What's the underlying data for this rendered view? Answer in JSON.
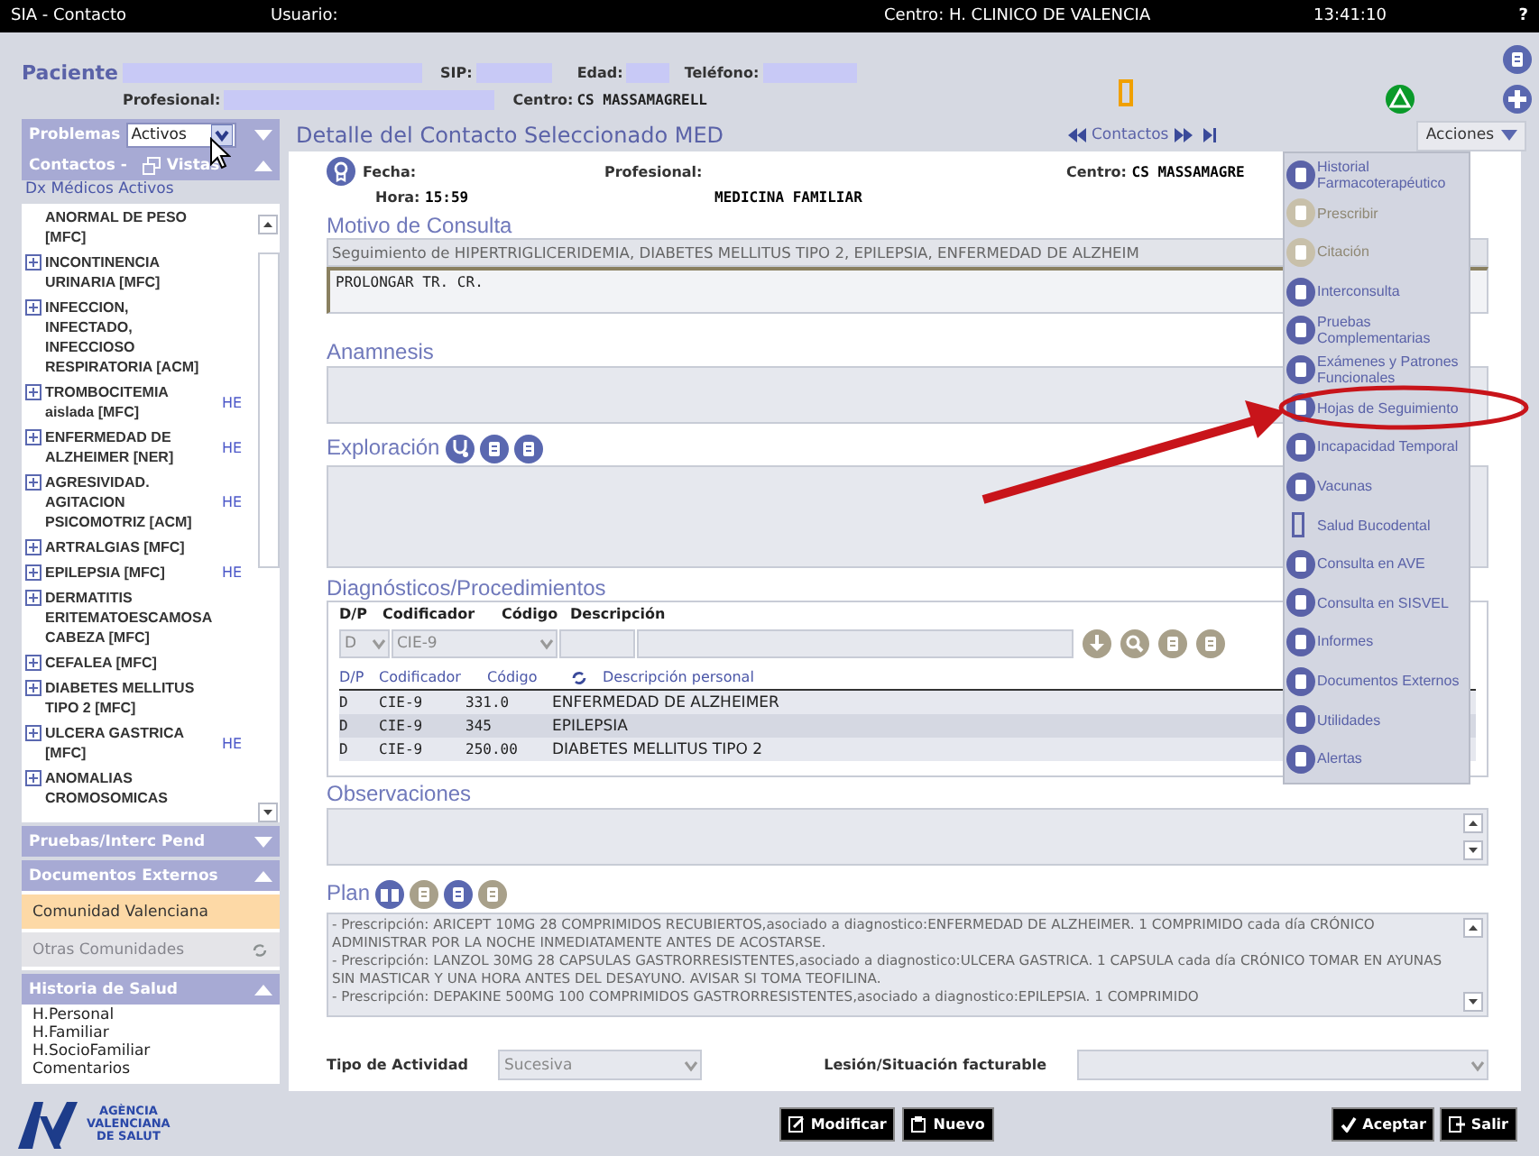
{
  "top_bar": {
    "title": "SIA - Contacto",
    "user_label": "Usuario:",
    "center": "Centro: H. CLINICO DE VALENCIA",
    "time": "13:41:10",
    "help": "?"
  },
  "patient": {
    "label": "Paciente",
    "sip_label": "SIP:",
    "age_label": "Edad:",
    "phone_label": "Teléfono:",
    "professional_label": "Profesional:",
    "center_label": "Centro:",
    "center": "CS MASSAMAGRELL"
  },
  "sidebar": {
    "problems": {
      "label": "Problemas",
      "filter": "Activos",
      "expanded": false
    },
    "contacts": {
      "label": "Contactos -",
      "views": "Vistas",
      "expanded": true
    },
    "list_title": "Dx Médicos Activos",
    "items": [
      {
        "name": "ANORMAL DE PESO [MFC]",
        "expander": false
      },
      {
        "name": "INCONTINENCIA URINARIA [MFC]",
        "expander": true
      },
      {
        "name": "INFECCION, INFECTADO, INFECCIOSO RESPIRATORIA [ACM]",
        "expander": true
      },
      {
        "name": "TROMBOCITEMIA aislada [MFC]",
        "expander": true,
        "tag": "HE"
      },
      {
        "name": "ENFERMEDAD DE ALZHEIMER [NER]",
        "expander": true,
        "tag": "HE"
      },
      {
        "name": "AGRESIVIDAD. AGITACION PSICOMOTRIZ [ACM]",
        "expander": true,
        "tag": "HE"
      },
      {
        "name": "ARTRALGIAS [MFC]",
        "expander": true
      },
      {
        "name": "EPILEPSIA [MFC]",
        "expander": true,
        "tag": "HE"
      },
      {
        "name": "DERMATITIS ERITEMATOESCAMOSA CABEZA [MFC]",
        "expander": true
      },
      {
        "name": "CEFALEA [MFC]",
        "expander": true
      },
      {
        "name": "DIABETES MELLITUS TIPO 2 [MFC]",
        "expander": true
      },
      {
        "name": "ULCERA GASTRICA [MFC]",
        "expander": true,
        "tag": "HE"
      },
      {
        "name": "ANOMALIAS CROMOSOMICAS",
        "expander": true
      }
    ],
    "sections": [
      {
        "title": "Pruebas/Interc Pend",
        "expanded": false
      },
      {
        "title": "Documentos Externos",
        "expanded": true,
        "kind": "tabs",
        "items": [
          {
            "label": "Comunidad Valenciana",
            "selected": true,
            "disabled": false
          },
          {
            "label": "Otras Comunidades",
            "selected": false,
            "disabled": true
          }
        ]
      },
      {
        "title": "Historia de Salud",
        "expanded": true,
        "kind": "links",
        "items": [
          {
            "label": "H.Personal"
          },
          {
            "label": "H.Familiar"
          },
          {
            "label": "H.SocioFamiliar"
          },
          {
            "label": "Comentarios"
          }
        ]
      }
    ]
  },
  "main": {
    "title": "Detalle del Contacto Seleccionado MED",
    "nav_label": "Contactos",
    "actions_label": "Acciones",
    "contact": {
      "date_label": "Fecha:",
      "professional_label": "Profesional:",
      "center_label": "Centro:",
      "center": "CS MASSAMAGRE",
      "time_label": "Hora:",
      "time": "15:59",
      "specialty": "MEDICINA FAMILIAR"
    },
    "reason": {
      "title": "Motivo de Consulta",
      "summary": "Seguimiento de HIPERTRIGLICERIDEMIA, DIABETES MELLITUS TIPO 2, EPILEPSIA, ENFERMEDAD DE ALZHEIM",
      "value": "PROLONGAR TR. CR."
    },
    "anamnesis": {
      "title": "Anamnesis"
    },
    "exploration": {
      "title": "Exploración"
    },
    "diagnoses": {
      "title": "Diagnósticos/Procedimientos",
      "entry_labels": [
        "D/P",
        "Codificador",
        "Código",
        "Descripción"
      ],
      "entry": {
        "type": "D",
        "coder": "CIE-9"
      },
      "columns": [
        "D/P",
        "Codificador",
        "Código",
        "Descripción personal"
      ],
      "rows": [
        [
          "D",
          "CIE-9",
          "331.0",
          "ENFERMEDAD DE ALZHEIMER"
        ],
        [
          "D",
          "CIE-9",
          "345",
          "EPILEPSIA"
        ],
        [
          "D",
          "CIE-9",
          "250.00",
          "DIABETES MELLITUS TIPO 2"
        ]
      ]
    },
    "observations": {
      "title": "Observaciones"
    },
    "plan": {
      "title": "Plan",
      "text": [
        "- Prescripción: ARICEPT 10MG 28 COMPRIMIDOS RECUBIERTOS,asociado a diagnostico:ENFERMEDAD DE ALZHEIMER. 1 COMPRIMIDO cada día CRÓNICO ADMINISTRAR POR LA NOCHE INMEDIATAMENTE ANTES DE ACOSTARSE.",
        "- Prescripción: LANZOL 30MG 28 CAPSULAS GASTRORRESISTENTES,asociado a diagnostico:ULCERA GASTRICA. 1 CAPSULA cada día CRÓNICO TOMAR EN AYUNAS SIN MASTICAR Y UNA HORA ANTES DEL DESAYUNO. AVISAR SI TOMA TEOFILINA.",
        "- Prescripción: DEPAKINE 500MG 100 COMPRIMIDOS GASTRORRESISTENTES,asociado a diagnostico:EPILEPSIA. 1 COMPRIMIDO"
      ]
    },
    "activity": {
      "label": "Tipo de Actividad",
      "value": "Sucesiva"
    },
    "billable": {
      "label": "Lesión/Situación facturable"
    }
  },
  "actions_menu": [
    {
      "label": "Historial Farmacoterapéutico",
      "disabled": false
    },
    {
      "label": "Prescribir",
      "disabled": true
    },
    {
      "label": "Citación",
      "disabled": true
    },
    {
      "label": "Interconsulta",
      "disabled": false
    },
    {
      "label": "Pruebas Complementarias",
      "disabled": false
    },
    {
      "label": "Exámenes y Patrones Funcionales",
      "disabled": false
    },
    {
      "label": "Hojas de Seguimiento",
      "disabled": false
    },
    {
      "label": "Incapacidad Temporal",
      "disabled": false
    },
    {
      "label": "Vacunas",
      "disabled": false
    },
    {
      "label": "Salud Bucodental",
      "disabled": false
    },
    {
      "label": "Consulta en AVE",
      "disabled": false
    },
    {
      "label": "Consulta en SISVEL",
      "disabled": false
    },
    {
      "label": "Informes",
      "disabled": false
    },
    {
      "label": "Documentos Externos",
      "disabled": false
    },
    {
      "label": "Utilidades",
      "disabled": false
    },
    {
      "label": "Alertas",
      "disabled": false
    }
  ],
  "footer": {
    "logo": [
      "AGÈNCIA",
      "VALENCIANA",
      "DE SALUT"
    ],
    "buttons": [
      "Modificar",
      "Nuevo"
    ],
    "confirm_buttons": [
      "Aceptar",
      "Salir"
    ]
  }
}
